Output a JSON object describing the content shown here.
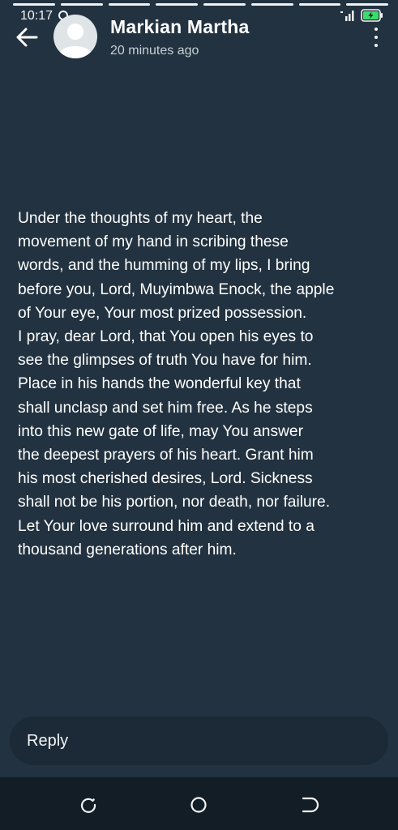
{
  "story": {
    "segments_total": 8,
    "segments_viewed": 8
  },
  "status_bar": {
    "time": "10:17",
    "icons": [
      "data-saver-icon",
      "signal-icon",
      "battery-charging-icon"
    ]
  },
  "header": {
    "back_icon": "arrow-left-icon",
    "avatar_icon": "default-avatar-icon",
    "name": "Markian Martha",
    "time_ago": "20 minutes ago",
    "menu_icon": "more-vertical-icon"
  },
  "caption": {
    "text": "Under the thoughts of my heart, the\nmovement of my hand in scribing these\nwords, and the humming of my lips, I bring\nbefore you, Lord, Muyimbwa Enock, the apple\nof Your eye, Your most prized possession.\nI pray, dear Lord, that You open his eyes to\nsee the glimpses of truth You have for him.\nPlace in his hands the wonderful key that\nshall unclasp and set him free. As he steps\ninto this new gate of life, may You answer\nthe deepest prayers of his heart. Grant him\nhis most cherished desires, Lord. Sickness\nshall not be his portion, nor death, nor failure.\nLet Your love surround him and extend to a\nthousand generations after him."
  },
  "reply": {
    "label": "Reply"
  },
  "nav": {
    "icons": [
      "recents-icon",
      "home-icon",
      "back-icon"
    ]
  },
  "colors": {
    "background": "#223240",
    "reply_background": "#1b2a36",
    "navbar": "#131d25",
    "battery_accent": "#3ddc6a"
  }
}
